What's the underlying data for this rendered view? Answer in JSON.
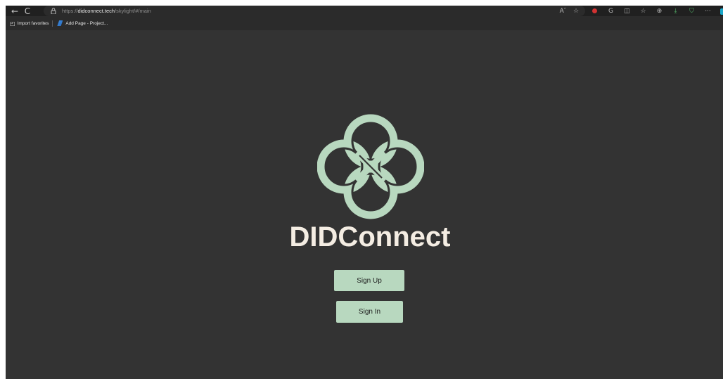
{
  "browser": {
    "back_icon": "←",
    "reload_icon": "C",
    "lock_icon": "⛒",
    "url_scheme": "https://",
    "url_domain": "didconnect.tech",
    "url_path": "/skylight/#/main",
    "read_aloud_icon": "Aʹ",
    "favorite_icon": "☆",
    "toolbar_icons": [
      "●",
      "G",
      "◫",
      "☆",
      "⊕",
      "⤓",
      "⛉",
      "···"
    ]
  },
  "favorites_bar": {
    "items": [
      {
        "icon": "◰",
        "label": "Import favorites"
      },
      {
        "icon": "project",
        "label": "Add Page - Project..."
      }
    ]
  },
  "page": {
    "brand": "DIDConnect",
    "signup_label": "Sign Up",
    "signin_label": "Sign In",
    "accent_color": "#b8d8bf",
    "background_color": "#333333",
    "text_color": "#f4ede3"
  }
}
